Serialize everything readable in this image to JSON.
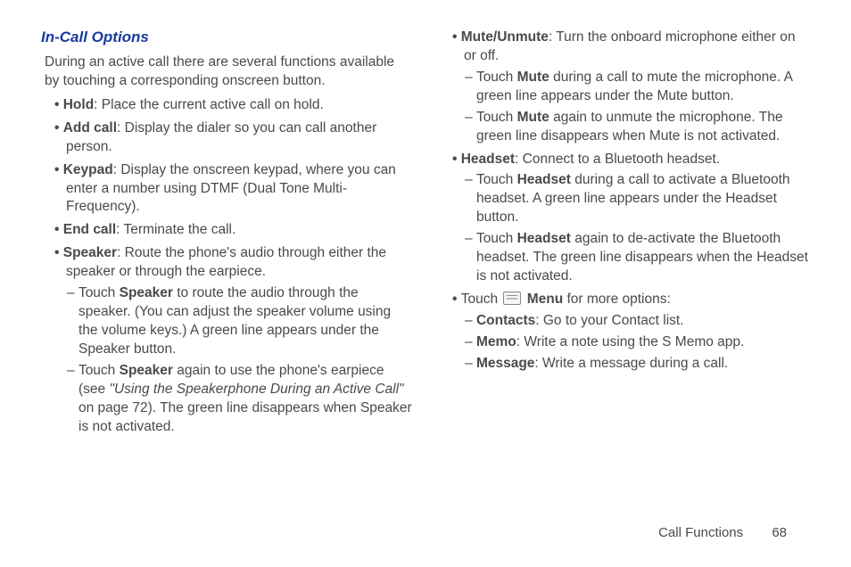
{
  "section_title": "In-Call Options",
  "intro": "During an active call there are several functions available by touching a corresponding onscreen button.",
  "col1": {
    "hold": {
      "label": "Hold",
      "text": ": Place the current active call on hold."
    },
    "addcall": {
      "label": "Add call",
      "text": ": Display the dialer so you can call another person."
    },
    "keypad": {
      "label": "Keypad",
      "text": ": Display the onscreen keypad, where you can enter a number using DTMF (Dual Tone Multi-Frequency)."
    },
    "endcall": {
      "label": "End call",
      "text": ": Terminate the call."
    },
    "speaker": {
      "label": "Speaker",
      "text": ": Route the phone's audio through either the speaker or through the earpiece."
    },
    "speaker_s1a": "Touch ",
    "speaker_s1_label": "Speaker",
    "speaker_s1b": " to route the audio through the speaker. (You can adjust the speaker volume using the volume keys.) A green line appears under the Speaker button.",
    "speaker_s2a": "Touch ",
    "speaker_s2_label": "Speaker",
    "speaker_s2b": " again to use the phone's earpiece (see ",
    "speaker_s2_ref": "\"Using the Speakerphone During an Active Call\"",
    "speaker_s2c": " on page 72). The green line disappears when Speaker is not activated."
  },
  "col2": {
    "mute": {
      "label": "Mute/Unmute",
      "text": ": Turn the onboard microphone either on or off."
    },
    "mute_s1a": "Touch ",
    "mute_s1_label": "Mute",
    "mute_s1b": " during a call to mute the microphone. A green line appears under the Mute button.",
    "mute_s2a": "Touch ",
    "mute_s2_label": "Mute",
    "mute_s2b": " again to unmute the microphone. The green line disappears when Mute is not activated.",
    "headset": {
      "label": "Headset",
      "text": ": Connect to a Bluetooth headset."
    },
    "headset_s1a": "Touch ",
    "headset_s1_label": "Headset",
    "headset_s1b": " during a call to activate a Bluetooth headset. A green line appears under the Headset button.",
    "headset_s2a": "Touch ",
    "headset_s2_label": "Headset",
    "headset_s2b": " again to de-activate the Bluetooth headset. The green line disappears when the Headset is not activated.",
    "menu_a": "Touch ",
    "menu_label": "Menu",
    "menu_b": " for more options:",
    "contacts": {
      "label": "Contacts",
      "text": ": Go to your Contact list."
    },
    "memo": {
      "label": "Memo",
      "text": ": Write a note using the S Memo app."
    },
    "message": {
      "label": "Message",
      "text": ": Write a message during a call."
    }
  },
  "footer": {
    "section": "Call Functions",
    "page": "68"
  }
}
